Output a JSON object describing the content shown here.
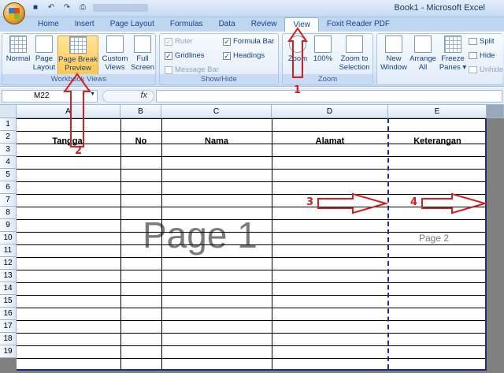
{
  "window": {
    "title": "Book1 - Microsoft Excel"
  },
  "tabs": [
    {
      "label": "Home"
    },
    {
      "label": "Insert"
    },
    {
      "label": "Page Layout"
    },
    {
      "label": "Formulas"
    },
    {
      "label": "Data"
    },
    {
      "label": "Review"
    },
    {
      "label": "View",
      "active": true
    },
    {
      "label": "Foxit Reader PDF"
    }
  ],
  "ribbon": {
    "workbook_views": {
      "label": "Workbook Views",
      "normal": "Normal",
      "page_layout_1": "Page",
      "page_layout_2": "Layout",
      "page_break_1": "Page Break",
      "page_break_2": "Preview",
      "custom_1": "Custom",
      "custom_2": "Views",
      "full_1": "Full",
      "full_2": "Screen"
    },
    "show_hide": {
      "label": "Show/Hide",
      "ruler": "Ruler",
      "gridlines": "Gridlines",
      "message_bar": "Message Bar",
      "formula_bar": "Formula Bar",
      "headings": "Headings"
    },
    "zoom": {
      "label": "Zoom",
      "zoom": "Zoom",
      "hundred": "100%",
      "zoom_sel_1": "Zoom to",
      "zoom_sel_2": "Selection"
    },
    "window": {
      "new_1": "New",
      "new_2": "Window",
      "arrange_1": "Arrange",
      "arrange_2": "All",
      "freeze_1": "Freeze",
      "freeze_2": "Panes ▾",
      "split": "Split",
      "hide": "Hide",
      "unhide": "Unhide"
    }
  },
  "formula_bar": {
    "name_box": "M22",
    "fx": "fx",
    "value": ""
  },
  "sheet": {
    "columns": [
      "A",
      "B",
      "C",
      "D",
      "E"
    ],
    "rows": [
      "1",
      "2",
      "3",
      "4",
      "5",
      "6",
      "7",
      "8",
      "9",
      "10",
      "11",
      "12",
      "13",
      "14",
      "15",
      "16",
      "17",
      "18",
      "19"
    ],
    "headers": {
      "tanggal": "Tanggal",
      "no": "No",
      "nama": "Nama",
      "alamat": "Alamat",
      "keterangan": "Keterangan"
    },
    "watermark_page1": "Page 1",
    "watermark_page2": "Page 2"
  },
  "annotations": [
    "1",
    "2",
    "3",
    "4"
  ],
  "colors": {
    "annotation": "#d81e1e",
    "page_border": "#1b2f8a",
    "ribbon_bg": "#dbe8f7"
  }
}
